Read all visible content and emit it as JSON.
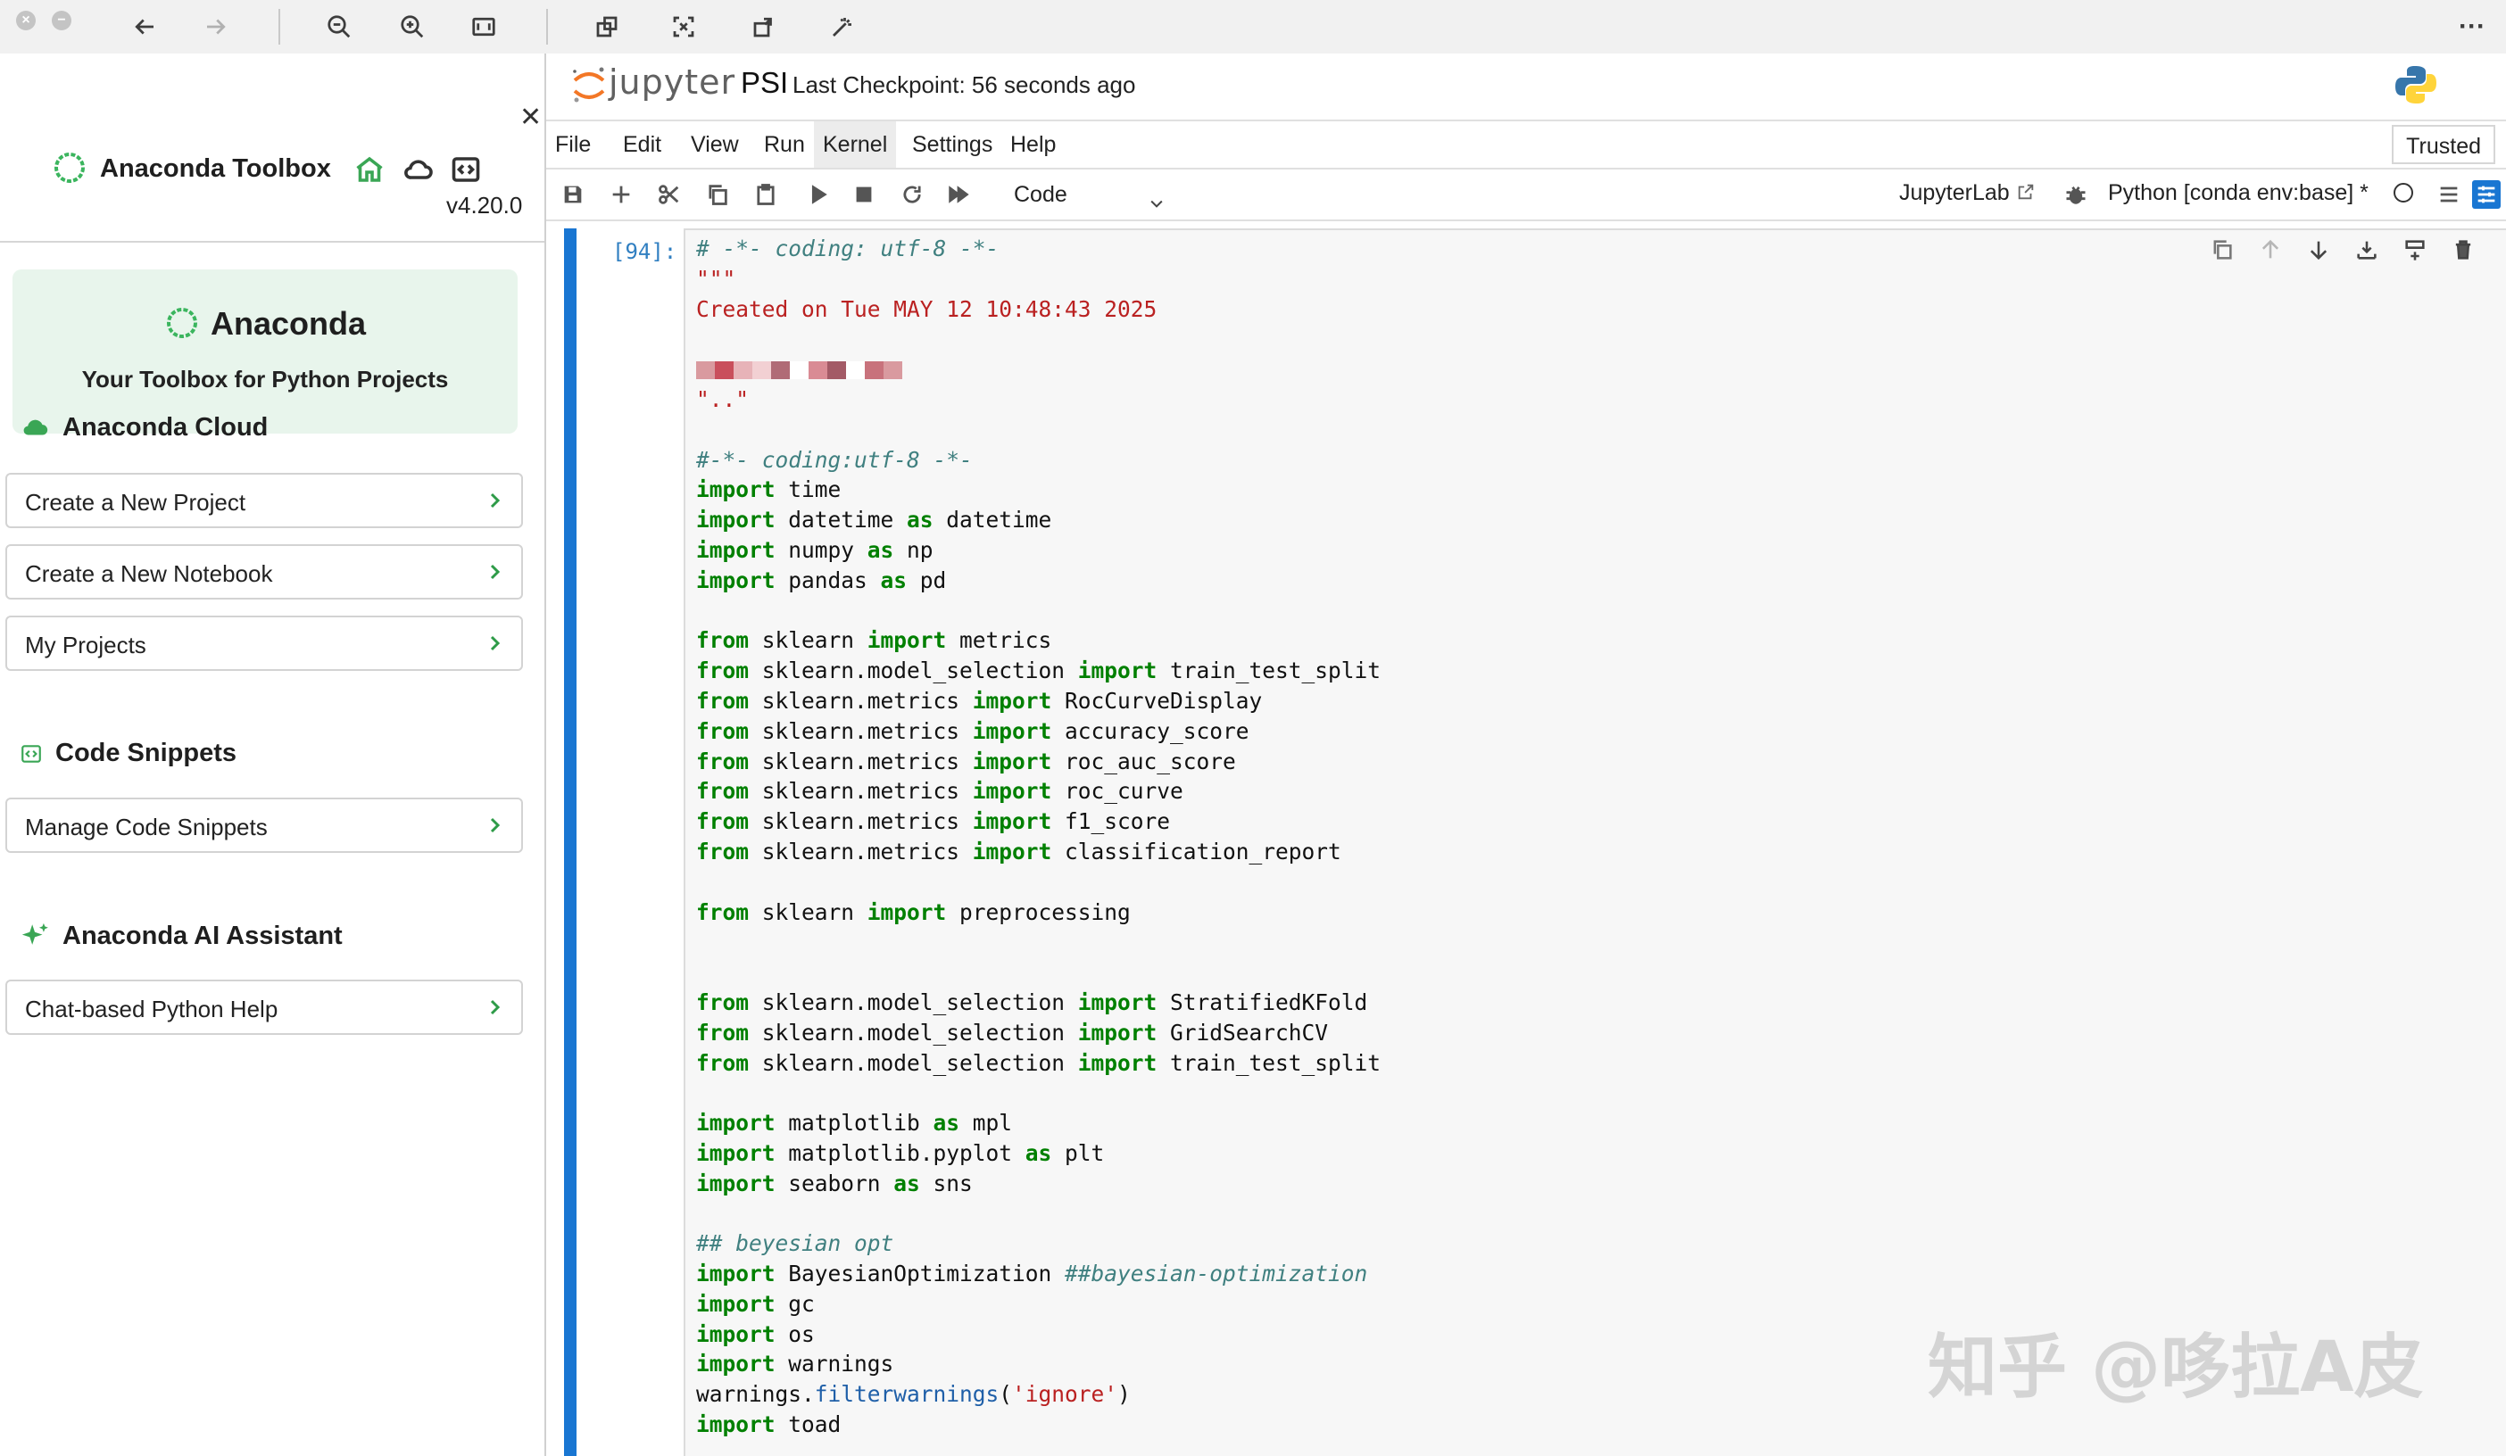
{
  "viewer": {
    "more_label": "···"
  },
  "sidebar": {
    "toolbox_title": "Anaconda Toolbox",
    "version": "v4.20.0",
    "hero_title": "Anaconda",
    "hero_subtitle": "Your Toolbox for Python Projects",
    "sections": [
      {
        "title": "Anaconda Cloud",
        "buttons": [
          "Create a New Project",
          "Create a New Notebook",
          "My Projects"
        ]
      },
      {
        "title": "Code Snippets",
        "buttons": [
          "Manage Code Snippets"
        ]
      },
      {
        "title": "Anaconda AI Assistant",
        "buttons": [
          "Chat-based Python Help"
        ]
      }
    ],
    "accent_color": "#2e9b48"
  },
  "header": {
    "app_name": "jupyter",
    "notebook_name": "PSI",
    "checkpoint": "Last Checkpoint: 56 seconds ago"
  },
  "menu": {
    "items": [
      "File",
      "Edit",
      "View",
      "Run",
      "Kernel",
      "Settings",
      "Help"
    ],
    "active": "Kernel",
    "trusted_label": "Trusted"
  },
  "toolbar": {
    "cell_type": "Code",
    "jupyterlab_label": "JupyterLab",
    "kernel_name": "Python [conda env:base] *"
  },
  "cell": {
    "prompt": "[94]:",
    "accent_color": "#1976d2",
    "code_lines": [
      {
        "t": [
          [
            "cm",
            "# -*- coding: utf-8 -*-"
          ]
        ]
      },
      {
        "t": [
          [
            "st",
            "\"\"\""
          ]
        ]
      },
      {
        "t": [
          [
            "st",
            "Created on Tue MAY 12 10:48:43 2025"
          ]
        ]
      },
      {
        "t": []
      },
      {
        "t": [
          [
            "redacted",
            ""
          ]
        ]
      },
      {
        "t": [
          [
            "st",
            "\"..\""
          ]
        ]
      },
      {
        "t": []
      },
      {
        "t": [
          [
            "cm",
            "#-*- coding:utf-8 -*-"
          ]
        ]
      },
      {
        "t": [
          [
            "kw",
            "import"
          ],
          [
            "",
            " time"
          ]
        ]
      },
      {
        "t": [
          [
            "kw",
            "import"
          ],
          [
            "",
            " datetime "
          ],
          [
            "kw",
            "as"
          ],
          [
            "",
            " datetime"
          ]
        ]
      },
      {
        "t": [
          [
            "kw",
            "import"
          ],
          [
            "",
            " numpy "
          ],
          [
            "kw",
            "as"
          ],
          [
            "",
            " np"
          ]
        ]
      },
      {
        "t": [
          [
            "kw",
            "import"
          ],
          [
            "",
            " pandas "
          ],
          [
            "kw",
            "as"
          ],
          [
            "",
            " pd"
          ]
        ]
      },
      {
        "t": []
      },
      {
        "t": [
          [
            "kw",
            "from"
          ],
          [
            "",
            " sklearn "
          ],
          [
            "kw",
            "import"
          ],
          [
            "",
            " metrics"
          ]
        ]
      },
      {
        "t": [
          [
            "kw",
            "from"
          ],
          [
            "",
            " sklearn.model_selection "
          ],
          [
            "kw",
            "import"
          ],
          [
            "",
            " train_test_split"
          ]
        ]
      },
      {
        "t": [
          [
            "kw",
            "from"
          ],
          [
            "",
            " sklearn.metrics "
          ],
          [
            "kw",
            "import"
          ],
          [
            "",
            " RocCurveDisplay"
          ]
        ]
      },
      {
        "t": [
          [
            "kw",
            "from"
          ],
          [
            "",
            " sklearn.metrics "
          ],
          [
            "kw",
            "import"
          ],
          [
            "",
            " accuracy_score"
          ]
        ]
      },
      {
        "t": [
          [
            "kw",
            "from"
          ],
          [
            "",
            " sklearn.metrics "
          ],
          [
            "kw",
            "import"
          ],
          [
            "",
            " roc_auc_score"
          ]
        ]
      },
      {
        "t": [
          [
            "kw",
            "from"
          ],
          [
            "",
            " sklearn.metrics "
          ],
          [
            "kw",
            "import"
          ],
          [
            "",
            " roc_curve"
          ]
        ]
      },
      {
        "t": [
          [
            "kw",
            "from"
          ],
          [
            "",
            " sklearn.metrics "
          ],
          [
            "kw",
            "import"
          ],
          [
            "",
            " f1_score"
          ]
        ]
      },
      {
        "t": [
          [
            "kw",
            "from"
          ],
          [
            "",
            " sklearn.metrics "
          ],
          [
            "kw",
            "import"
          ],
          [
            "",
            " classification_report"
          ]
        ]
      },
      {
        "t": []
      },
      {
        "t": [
          [
            "kw",
            "from"
          ],
          [
            "",
            " sklearn "
          ],
          [
            "kw",
            "import"
          ],
          [
            "",
            " preprocessing"
          ]
        ]
      },
      {
        "t": []
      },
      {
        "t": []
      },
      {
        "t": [
          [
            "kw",
            "from"
          ],
          [
            "",
            " sklearn.model_selection "
          ],
          [
            "kw",
            "import"
          ],
          [
            "",
            " StratifiedKFold"
          ]
        ]
      },
      {
        "t": [
          [
            "kw",
            "from"
          ],
          [
            "",
            " sklearn.model_selection "
          ],
          [
            "kw",
            "import"
          ],
          [
            "",
            " GridSearchCV"
          ]
        ]
      },
      {
        "t": [
          [
            "kw",
            "from"
          ],
          [
            "",
            " sklearn.model_selection "
          ],
          [
            "kw",
            "import"
          ],
          [
            "",
            " train_test_split"
          ]
        ]
      },
      {
        "t": []
      },
      {
        "t": [
          [
            "kw",
            "import"
          ],
          [
            "",
            " matplotlib "
          ],
          [
            "kw",
            "as"
          ],
          [
            "",
            " mpl"
          ]
        ]
      },
      {
        "t": [
          [
            "kw",
            "import"
          ],
          [
            "",
            " matplotlib.pyplot "
          ],
          [
            "kw",
            "as"
          ],
          [
            "",
            " plt"
          ]
        ]
      },
      {
        "t": [
          [
            "kw",
            "import"
          ],
          [
            "",
            " seaborn "
          ],
          [
            "kw",
            "as"
          ],
          [
            "",
            " sns"
          ]
        ]
      },
      {
        "t": []
      },
      {
        "t": [
          [
            "cm",
            "## beyesian opt"
          ]
        ]
      },
      {
        "t": [
          [
            "kw",
            "import"
          ],
          [
            "",
            " BayesianOptimization "
          ],
          [
            "cm",
            "##bayesian-optimization"
          ]
        ]
      },
      {
        "t": [
          [
            "kw",
            "import"
          ],
          [
            "",
            " gc"
          ]
        ]
      },
      {
        "t": [
          [
            "kw",
            "import"
          ],
          [
            "",
            " os"
          ]
        ]
      },
      {
        "t": [
          [
            "kw",
            "import"
          ],
          [
            "",
            " warnings"
          ]
        ]
      },
      {
        "t": [
          [
            "",
            "warnings."
          ],
          [
            "fn",
            "filterwarnings"
          ],
          [
            "",
            "("
          ],
          [
            "st",
            "'ignore'"
          ],
          [
            "",
            ")"
          ]
        ]
      },
      {
        "t": [
          [
            "kw",
            "import"
          ],
          [
            "",
            " toad"
          ]
        ]
      }
    ]
  },
  "watermark": "知乎 @哆拉A皮"
}
